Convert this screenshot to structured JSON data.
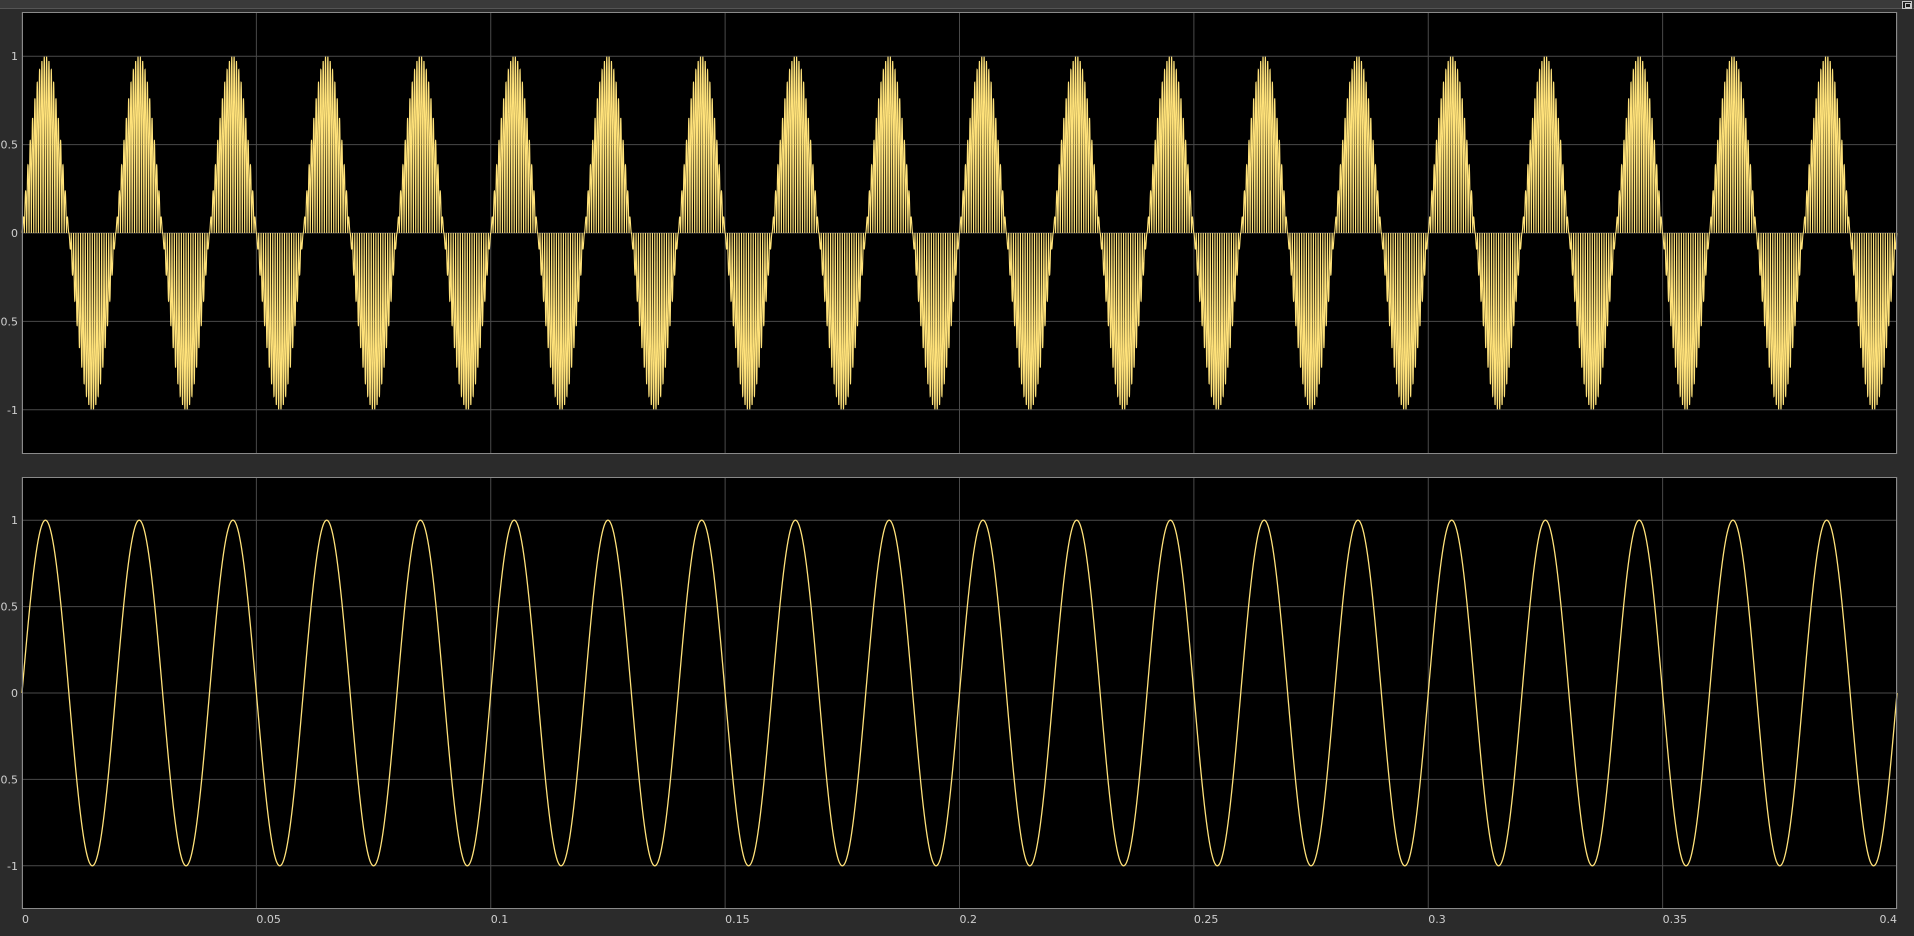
{
  "colors": {
    "background": "#2b2b2b",
    "axes_background": "#000000",
    "grid": "#4a4a4a",
    "axes_border": "#8a8a8a",
    "signal": "#ffe27a",
    "tick_text": "#cfcfcf"
  },
  "icons": {
    "undock": "undock-icon"
  },
  "chart_data": [
    {
      "type": "line",
      "title": "",
      "xlabel": "",
      "ylabel": "",
      "xlim": [
        0,
        0.4
      ],
      "ylim": [
        -1.25,
        1.25
      ],
      "grid": true,
      "xticks": [
        0,
        0.05,
        0.1,
        0.15,
        0.2,
        0.25,
        0.3,
        0.35,
        0.4
      ],
      "xtick_labels": [],
      "yticks": [
        1,
        0.5,
        0,
        -0.5,
        -1
      ],
      "ytick_labels": [
        "1",
        "0.5",
        "0",
        "-0.5",
        "-1"
      ],
      "series": [
        {
          "signal": "modulated",
          "description_values": "sin(2*pi*50*t) * |sin(2*pi*1000*t)|",
          "envelope_frequency_hz": 50,
          "carrier_frequency_hz": 1000,
          "amplitude": 1
        }
      ]
    },
    {
      "type": "line",
      "title": "",
      "xlabel": "",
      "ylabel": "",
      "xlim": [
        0,
        0.4
      ],
      "ylim": [
        -1.25,
        1.25
      ],
      "grid": true,
      "xticks": [
        0,
        0.05,
        0.1,
        0.15,
        0.2,
        0.25,
        0.3,
        0.35,
        0.4
      ],
      "xtick_labels": [
        "0",
        "0.05",
        "0.1",
        "0.15",
        "0.2",
        "0.25",
        "0.3",
        "0.35",
        "0.4"
      ],
      "yticks": [
        1,
        0.5,
        0,
        -0.5,
        -1
      ],
      "ytick_labels": [
        "1",
        "0.5",
        "0",
        "-0.5",
        "-1"
      ],
      "series": [
        {
          "signal": "sine",
          "frequency_hz": 50,
          "amplitude": 1
        }
      ]
    }
  ]
}
